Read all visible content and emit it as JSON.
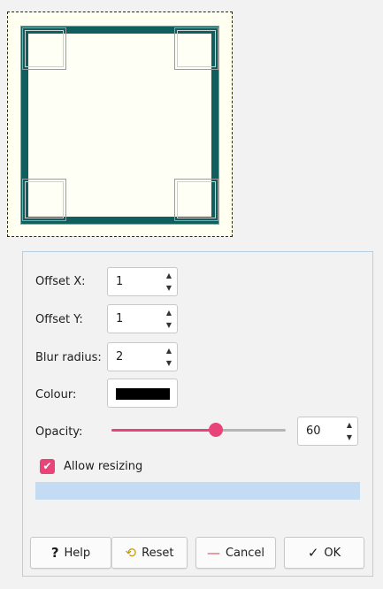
{
  "icons": {
    "help": "help-icon",
    "reset": "reset-icon",
    "cancel": "minus-icon",
    "ok": "check-icon",
    "spin_up": "up-arrow-icon",
    "spin_down": "down-arrow-icon"
  },
  "fields": {
    "offset_x": {
      "label": "Offset X:",
      "value": "1"
    },
    "offset_y": {
      "label": "Offset Y:",
      "value": "1"
    },
    "blur_radius": {
      "label": "Blur radius:",
      "value": "2"
    },
    "colour": {
      "label": "Colour:",
      "value": "#000000"
    },
    "opacity": {
      "label": "Opacity:",
      "value": "60",
      "fraction": 0.6
    }
  },
  "allow_resizing": {
    "label": "Allow resizing",
    "checked": true
  },
  "buttons": {
    "help": "Help",
    "reset": "Reset",
    "cancel": "Cancel",
    "ok": "OK"
  },
  "colors": {
    "accent": "#e9447a",
    "frame": "#115e5e",
    "progress": "#c3dcf4"
  }
}
